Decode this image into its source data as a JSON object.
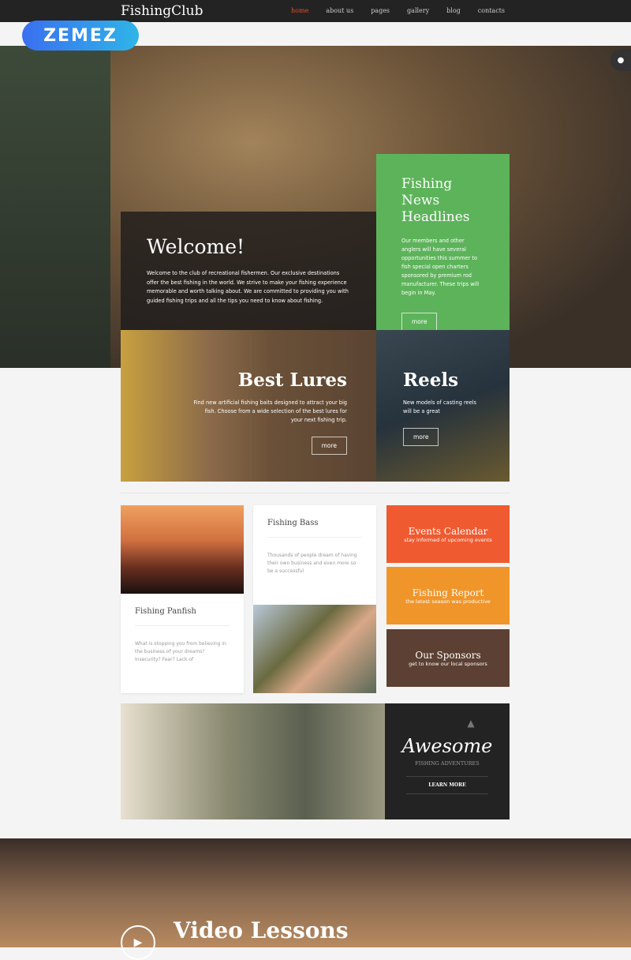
{
  "nav": {
    "logo": "FishingClub",
    "items": [
      "home",
      "about us",
      "pages",
      "gallery",
      "blog",
      "contacts"
    ],
    "active": "home"
  },
  "badge": "ZEMEZ",
  "welcome": {
    "title": "Welcome!",
    "text": "Welcome to the club of recreational fishermen. Our exclusive destinations offer the best fishing in the world. We strive to make your fishing experience memorable and worth talking about. We are committed to providing you with guided fishing trips and all the tips you need to know about fishing."
  },
  "news": {
    "title": "Fishing News Headlines",
    "text": "Our members and other anglers will have several opportunities this summer to fish special open charters sponsored by premium rod manufacturer. These trips will begin in May.",
    "button": "more"
  },
  "lures": {
    "title": "Best Lures",
    "text": "Find new artificial fishing baits designed to attract your big fish. Choose from a wide selection of the best lures for your next fishing trip.",
    "button": "more"
  },
  "reels": {
    "title": "Reels",
    "text": "New models of casting reels will be a great",
    "button": "more"
  },
  "cards": [
    {
      "title": "Fishing Panfish",
      "text": "What is stopping you from believing in the business of your dreams? Insecurity? Fear? Lack of"
    },
    {
      "title": "Fishing Bass",
      "text": "Thousands of people dream of having their own business and even more so be a successful"
    }
  ],
  "tiles": [
    {
      "title": "Events Calendar",
      "subtitle": "stay informed of upcoming events",
      "color": "#ef5a30"
    },
    {
      "title": "Fishing Report",
      "subtitle": "the latest season was productive",
      "color": "#f0952a"
    },
    {
      "title": "Our Sponsors",
      "subtitle": "get to know our local sponsors",
      "color": "#5c4033"
    }
  ],
  "banner": {
    "title": "Awesome",
    "subtitle": "FISHING ADVENTURES",
    "button": "LEARN MORE"
  },
  "video": {
    "title": "Video Lessons"
  },
  "colors": {
    "accent": "#e0502f",
    "green": "#5db35a"
  }
}
